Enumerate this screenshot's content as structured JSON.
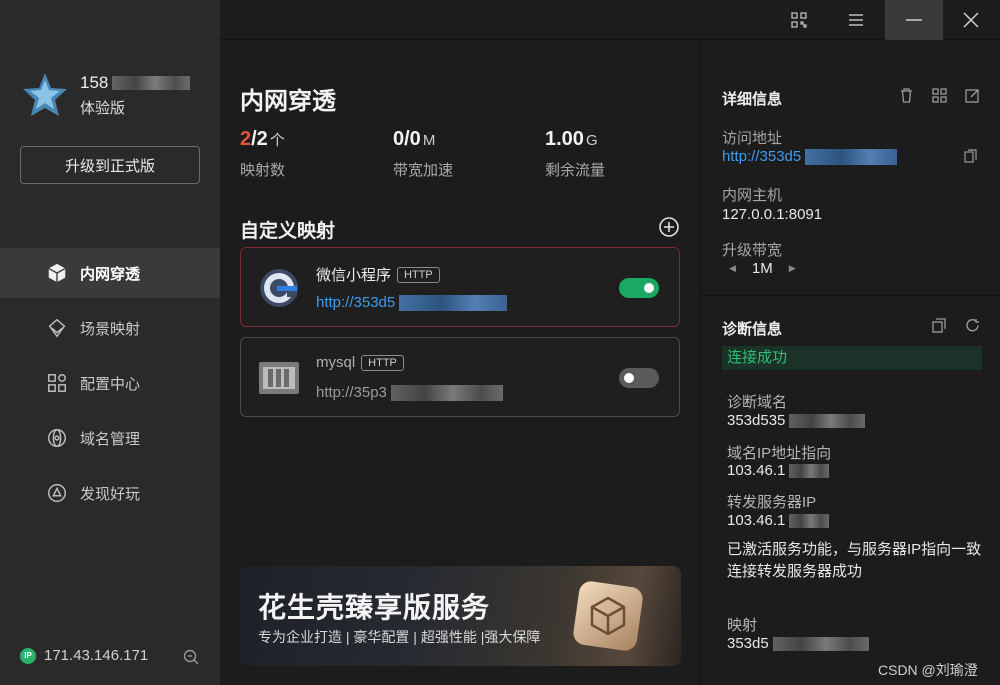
{
  "sidebar": {
    "user_phone": "158",
    "edition": "体验版",
    "upgrade_label": "升级到正式版",
    "nav": [
      {
        "label": "内网穿透",
        "icon": "cube-icon",
        "active": true
      },
      {
        "label": "场景映射",
        "icon": "scene-icon",
        "active": false
      },
      {
        "label": "配置中心",
        "icon": "grid-icon",
        "active": false
      },
      {
        "label": "域名管理",
        "icon": "atom-icon",
        "active": false
      },
      {
        "label": "发现好玩",
        "icon": "discover-icon",
        "active": false
      }
    ],
    "ip_badge": "IP",
    "ip": "171.43.146.171"
  },
  "main": {
    "title": "内网穿透",
    "stats": [
      {
        "value_highlight": "2",
        "value_rest": "/2",
        "unit": "个",
        "label": "映射数"
      },
      {
        "value_highlight": "",
        "value_rest": "0/0",
        "unit": "M",
        "label": "带宽加速"
      },
      {
        "value_highlight": "",
        "value_rest": "1.00",
        "unit": "G",
        "label": "剩余流量"
      }
    ],
    "section_title": "自定义映射",
    "mappings": [
      {
        "name": "微信小程序",
        "protocol": "HTTP",
        "url": "http://353d5",
        "enabled": true
      },
      {
        "name": "mysql",
        "protocol": "HTTP",
        "url": "http://35p3",
        "enabled": false
      }
    ],
    "banner": {
      "title": "花生壳臻享版服务",
      "subtitle": "专为企业打造 | 豪华配置 | 超强性能 |强大保障"
    }
  },
  "detail": {
    "title": "详细信息",
    "access_label": "访问地址",
    "access_value": "http://353d5",
    "host_label": "内网主机",
    "host_value": "127.0.0.1:8091",
    "bw_label": "升级带宽",
    "bw_value": "1M"
  },
  "diagnosis": {
    "title": "诊断信息",
    "status": "连接成功",
    "domain_label": "诊断域名",
    "domain_value": "353d535",
    "ip_label": "域名IP地址指向",
    "ip_value": "103.46.1",
    "fwd_label": "转发服务器IP",
    "fwd_value": "103.46.1",
    "msg_line1": "已激活服务功能，与服务器IP指向一致",
    "msg_line2": "连接转发服务器成功",
    "map_label": "映射",
    "map_value": "353d5"
  },
  "watermark": "CSDN @刘瑜澄",
  "colors": {
    "accent_red": "#e0533d",
    "link": "#3e9cf0",
    "toggle_on": "#1aa864",
    "success": "#2fbf74"
  }
}
